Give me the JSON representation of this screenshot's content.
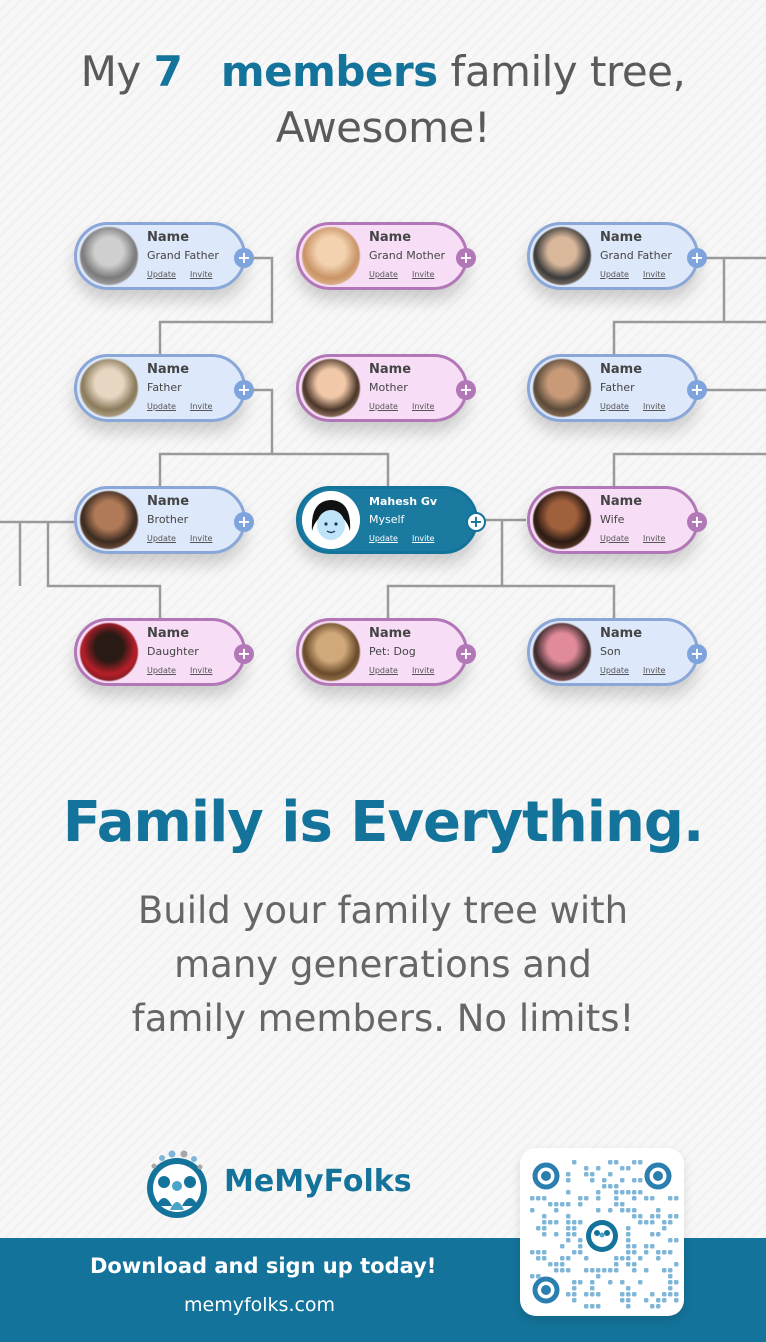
{
  "header": {
    "prefix": "My",
    "count": "7",
    "accent_word": "members",
    "suffix": "family tree,",
    "line2": "Awesome!"
  },
  "tree": {
    "cards": [
      {
        "name": "Name",
        "relation": "Grand Father",
        "update": "Update",
        "invite": "Invite",
        "color": "blue"
      },
      {
        "name": "Name",
        "relation": "Grand Mother",
        "update": "Update",
        "invite": "Invite",
        "color": "pink"
      },
      {
        "name": "Name",
        "relation": "Grand Father",
        "update": "Update",
        "invite": "Invite",
        "color": "blue"
      },
      {
        "name": "Name",
        "relation": "Father",
        "update": "Update",
        "invite": "Invite",
        "color": "blue"
      },
      {
        "name": "Name",
        "relation": "Mother",
        "update": "Update",
        "invite": "Invite",
        "color": "pink"
      },
      {
        "name": "Name",
        "relation": "Father",
        "update": "Update",
        "invite": "Invite",
        "color": "blue"
      },
      {
        "name": "Name",
        "relation": "Brother",
        "update": "Update",
        "invite": "Invite",
        "color": "blue"
      },
      {
        "name": "Mahesh Gv",
        "relation": "Myself",
        "update": "Update",
        "invite": "Invite",
        "color": "self"
      },
      {
        "name": "Name",
        "relation": "Wife",
        "update": "Update",
        "invite": "Invite",
        "color": "pink"
      },
      {
        "name": "Name",
        "relation": "Daughter",
        "update": "Update",
        "invite": "Invite",
        "color": "pink"
      },
      {
        "name": "Name",
        "relation": "Pet: Dog",
        "update": "Update",
        "invite": "Invite",
        "color": "pink"
      },
      {
        "name": "Name",
        "relation": "Son",
        "update": "Update",
        "invite": "Invite",
        "color": "blue"
      }
    ],
    "add_symbol": "+"
  },
  "tagline": "Family is Everything.",
  "description": {
    "line1": "Build your family tree with",
    "line2": "many generations and",
    "line3": "family members. No limits!"
  },
  "brand": {
    "name": "MeMyFolks",
    "logo_icon": "family-logo-icon"
  },
  "footer": {
    "cta": "Download and sign up today!",
    "url": "memyfolks.com",
    "qr_icon": "qr-code-icon"
  },
  "colors": {
    "accent": "#14739a",
    "blue_card": "#dde8fb",
    "pink_card": "#f7def6",
    "blue_border": "#8aa7d8",
    "pink_border": "#b277b6"
  }
}
